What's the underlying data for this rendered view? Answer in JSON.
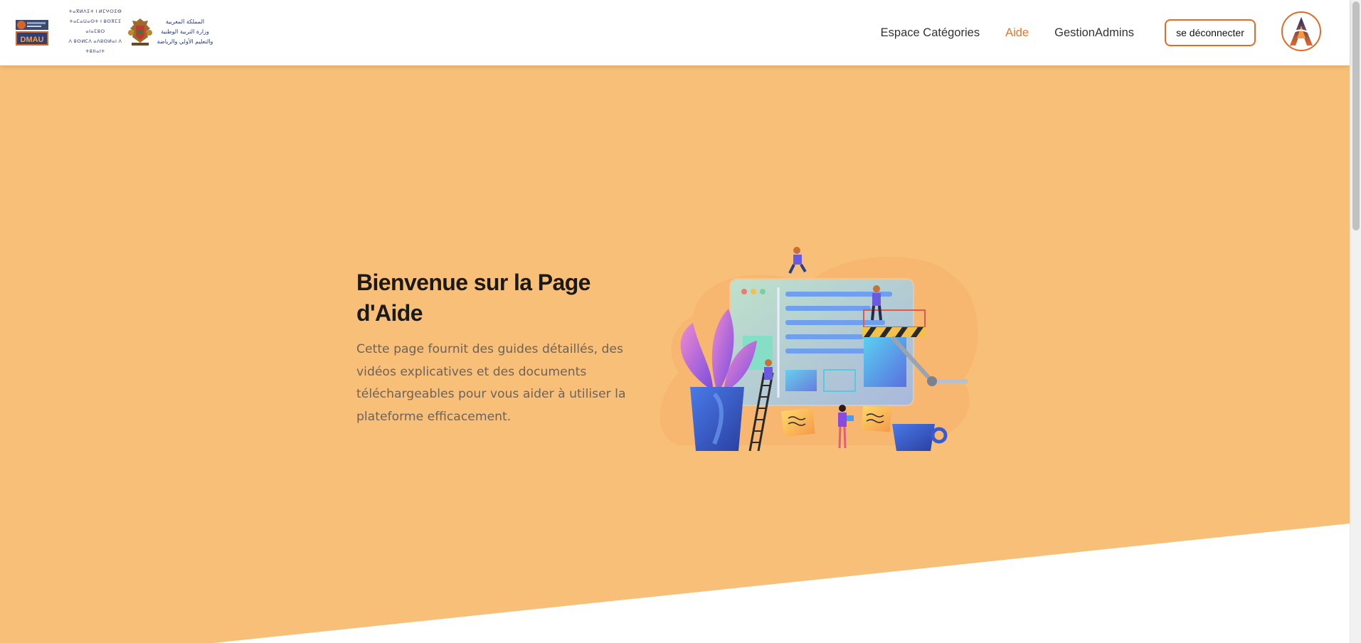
{
  "header": {
    "logo_dmau_text": "DMAU",
    "ministry_logo": {
      "tifinagh_lines": [
        "ⵜⴰⴳⵍⴷⵉⵜ ⵏ ⵍⵎⵖⵔⵉⴱ",
        "ⵜⴰⵎⴰⵡⴰⵙⵜ ⵏ ⵓⵙⴳⵎⵉ ⴰⵏⴰⵎⵓⵔ",
        "ⴷ ⵓⵙⵍⵎⴷ ⴰⴷⵓⵙⵍⴰⵏ ⴷ ⵜⵓⵏⵏⴰⵏⵜ"
      ],
      "arabic_lines": [
        "المملكة المغربية",
        "وزارة التربية الوطنية",
        "والتعليم الأولي والرياضة"
      ]
    },
    "nav": [
      {
        "label": "Espace Catégories",
        "active": false
      },
      {
        "label": "Aide",
        "active": true
      },
      {
        "label": "GestionAdmins",
        "active": false
      }
    ],
    "logout_label": "se déconnecter"
  },
  "hero": {
    "title": "Bienvenue sur la Page d'Aide",
    "description": "Cette page fournit des guides détaillés, des vidéos explicatives et des documents téléchargeables pour vous aider à utiliser la plateforme efficacement."
  },
  "colors": {
    "hero_background": "#f8bf78",
    "accent": "#e5762c",
    "nav_text": "#333333",
    "title_text": "#1a1a1a",
    "body_text": "#6e6259"
  },
  "icons": {
    "avatar": "letter-a-logo-icon",
    "illustration": "website-construction-illustration"
  }
}
